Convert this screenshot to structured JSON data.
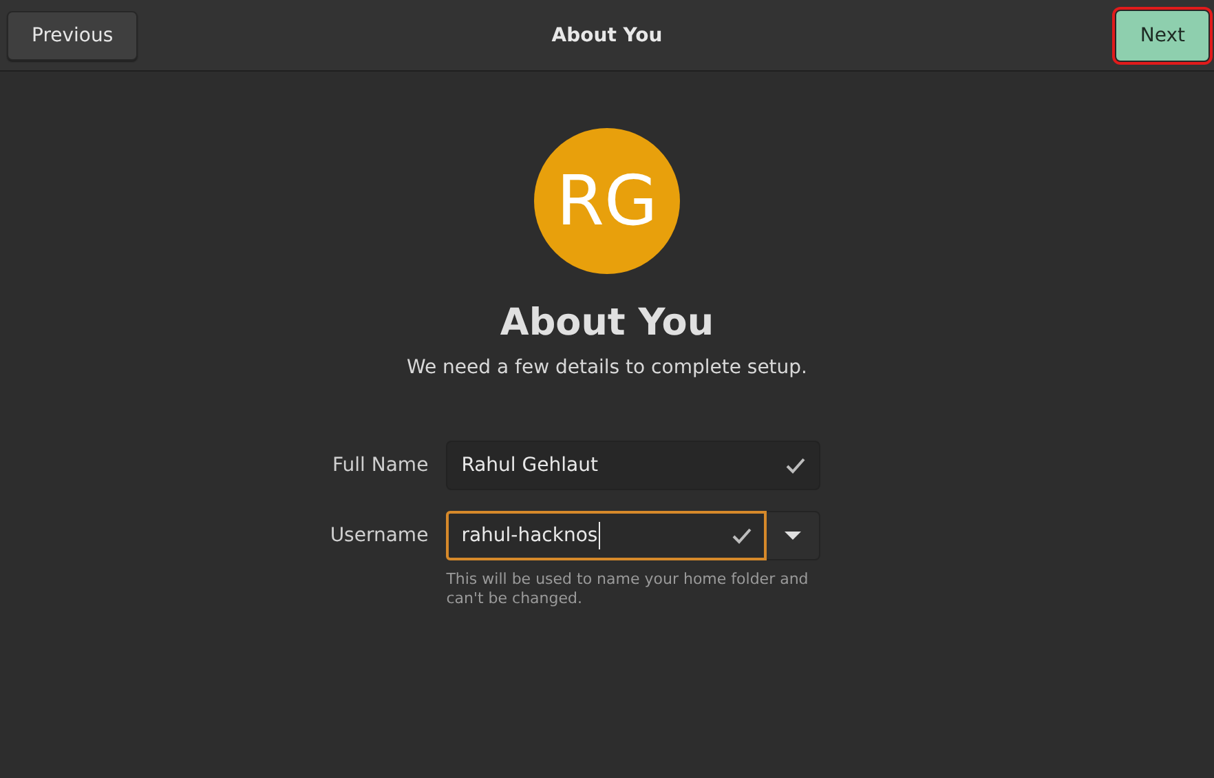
{
  "header": {
    "title": "About You",
    "previous_button": "Previous",
    "next_button": {
      "label": "Next",
      "highlighted": true
    }
  },
  "avatar": {
    "initials": "RG"
  },
  "heading": "About You",
  "subtitle": "We need a few details to complete setup.",
  "fields": [
    {
      "label": "Full Name",
      "value": "Rahul Gehlaut",
      "focused": false,
      "valid": true,
      "has_dropdown": false
    },
    {
      "label": "Username",
      "value": "rahul-hacknos",
      "focused": true,
      "valid": true,
      "has_dropdown": true,
      "hint": "This will be used to name your home folder and can't be changed."
    }
  ]
}
